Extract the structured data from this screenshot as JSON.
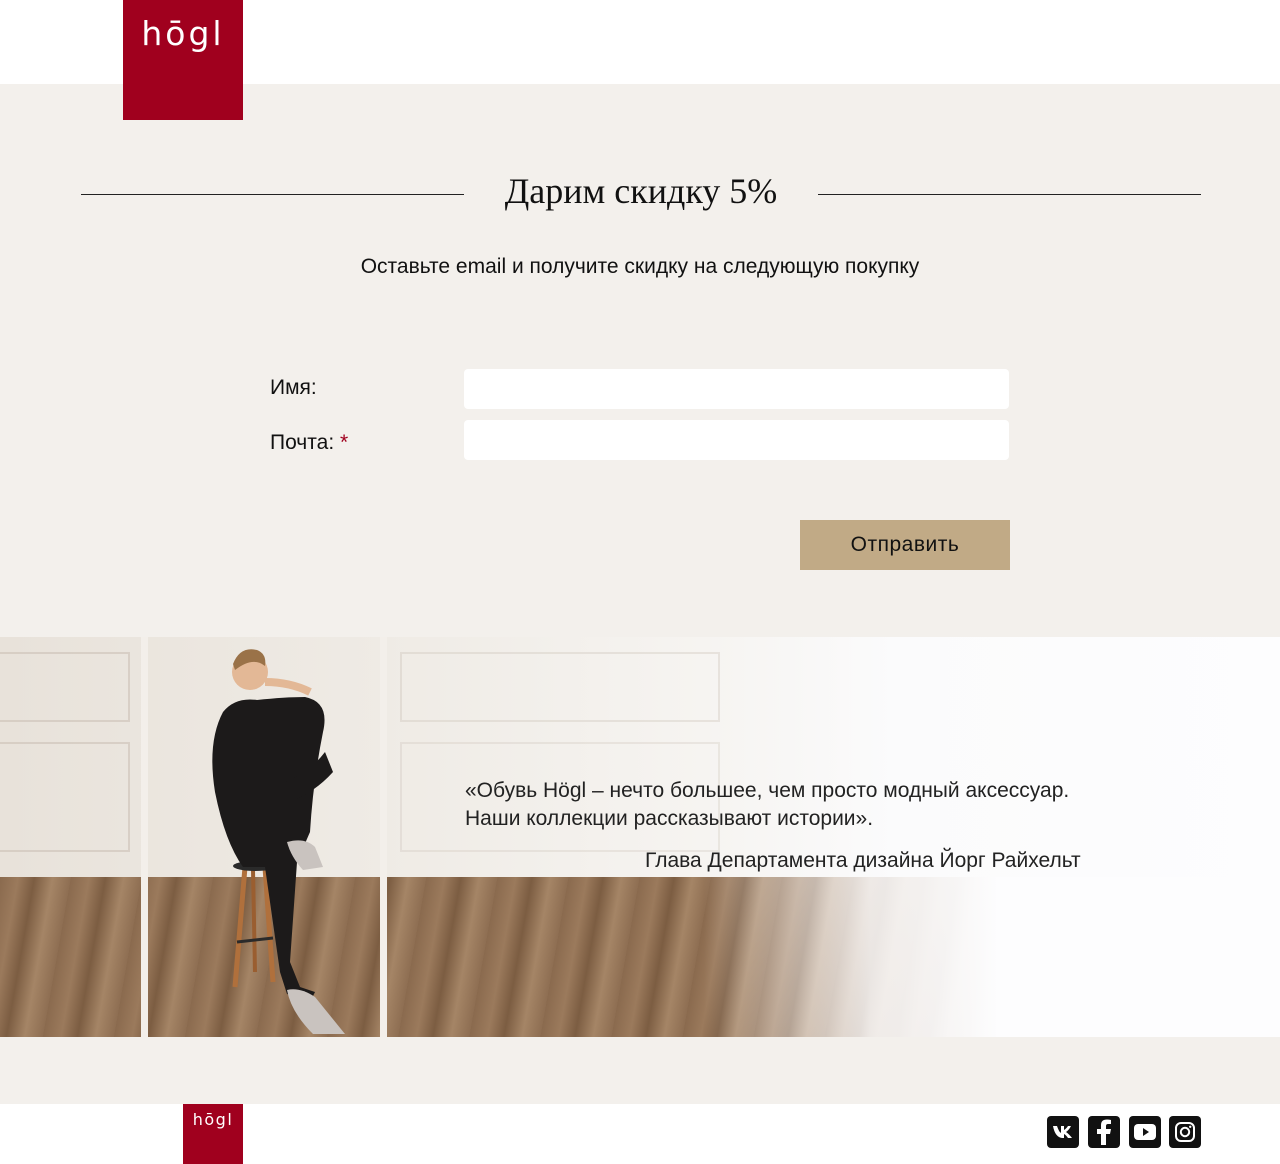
{
  "brand": {
    "logo_text": "hōgl",
    "color": "#a0001e"
  },
  "promo": {
    "title": "Дарим скидку 5%",
    "subtitle": "Оставьте email и получите скидку на следующую покупку"
  },
  "form": {
    "name_label": "Имя:",
    "email_label": "Почта:",
    "required_mark": "*",
    "name_value": "",
    "email_value": "",
    "submit_label": "Отправить",
    "submit_color": "#c1aa86"
  },
  "banner": {
    "quote_line1": "«Обувь Högl – нечто большее, чем просто модный аксессуар.",
    "quote_line2": "Наши коллекции рассказывают истории».",
    "author": "Глава Департамента дизайна Йорг Райхельт"
  },
  "footer": {
    "logo_text": "hōgl",
    "social": [
      "vk-icon",
      "facebook-icon",
      "youtube-icon",
      "instagram-icon"
    ]
  }
}
